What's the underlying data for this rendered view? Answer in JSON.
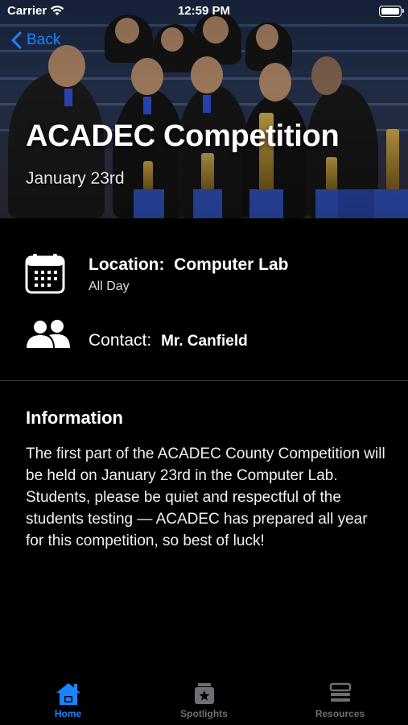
{
  "status_bar": {
    "carrier": "Carrier",
    "time": "12:59 PM"
  },
  "nav": {
    "back_label": "Back"
  },
  "event": {
    "title": "ACADEC Competition",
    "date": "January 23rd",
    "location_label": "Location:",
    "location_value": "Computer Lab",
    "time_text": "All Day",
    "contact_label": "Contact:",
    "contact_value": "Mr. Canfield"
  },
  "information": {
    "heading": "Information",
    "body": "The first part of the ACADEC County Competition will be held on January 23rd in the Computer Lab. Students, please be quiet and respectful of the students testing — ACADEC has prepared all year for this competition, so best of luck!"
  },
  "tab_bar": {
    "items": [
      {
        "label": "Home",
        "icon": "home-icon",
        "active": true
      },
      {
        "label": "Spotlights",
        "icon": "spotlights-icon",
        "active": false
      },
      {
        "label": "Resources",
        "icon": "resources-icon",
        "active": false
      }
    ]
  },
  "colors": {
    "accent": "#1a84ff",
    "background": "#000000",
    "inactive_tab": "#6e6e73"
  }
}
